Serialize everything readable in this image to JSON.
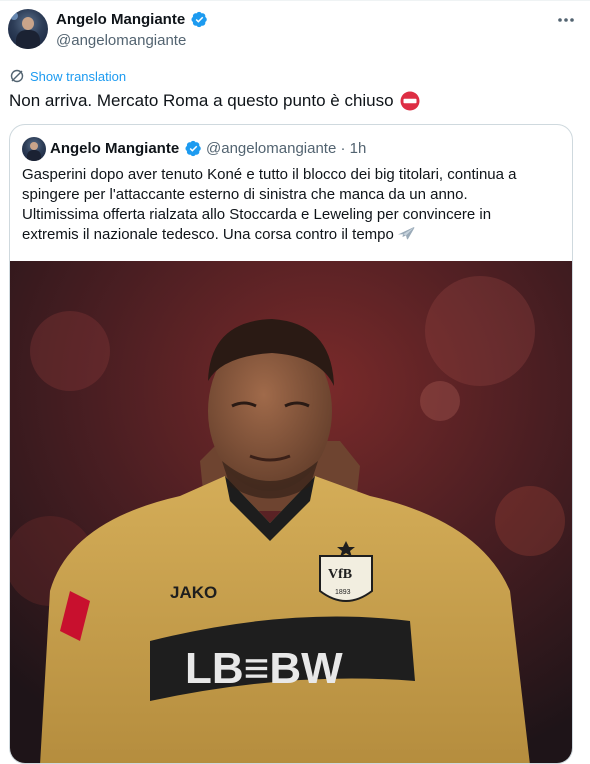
{
  "tweet": {
    "author_name": "Angelo Mangiante",
    "author_handle": "@angelomangiante",
    "show_translation": "Show translation",
    "text": "Non arriva. Mercato Roma a questo punto è chiuso"
  },
  "quoted": {
    "author_name": "Angelo Mangiante",
    "author_handle": "@angelomangiante",
    "time": "1h",
    "lines": [
      "Gasperini dopo aver tenuto Koné e tutto il blocco dei big titolari, continua a",
      "spingere per l'attaccante esterno di sinistra che manca da un anno.",
      "Ultimissima offerta rialzata allo Stoccarda e Leweling per convincere in",
      "extremis il nazionale tedesco. Una corsa contro il tempo"
    ],
    "photo": {
      "kit_brand": "JAKO",
      "sponsor": "LB≡BW",
      "crest_text": "VfB",
      "crest_year": "1893"
    }
  },
  "colors": {
    "accent": "#1d9bf0",
    "text": "#0f1419",
    "secondary_text": "#536471",
    "border": "#cfd9de",
    "jersey": "#c9a34e"
  },
  "icons": {
    "verified": "verified-badge-icon",
    "more": "more-options-icon",
    "translate": "translate-icon",
    "no_entry": "no-entry-emoji-icon",
    "plane": "airplane-emoji-icon"
  }
}
